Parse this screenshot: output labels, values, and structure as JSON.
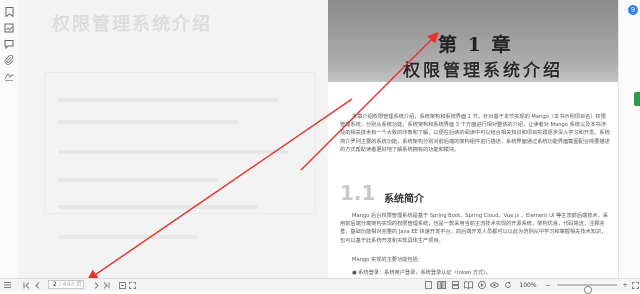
{
  "book": {
    "chapter_number": "第 1 章",
    "chapter_title": "权限管理系统介绍",
    "intro_text": "本章介绍权限管理系统介绍，系统架构和系统界面 1 节，针对基于本节实现的 Mango（本书示例项目名）权限管理系统，分别从系统功能，系统架构和系统界面 3 个方面进行相对整体的介绍，让读者对 Mango 系统以及本书涉及的相关技术有一个大致的印象和了解，以便在后续的阅读中可以结合相关知识和项目实践逐步深入学习和开发。系统简介罗列主要的系统功能，系统架构分别对前后端的架构组件进行描述，系统界面通过系统功能界面截图配合简要描述的方式帮助读者更好地了解系统拥有的功能和模块。",
    "section_number": "1.1",
    "section_title": "系统简介",
    "section_text": "Mango 后台权限管理系统是基于 Spring Boot、Spring Cloud、Vue.js 、Element UI 等主流前后端技术，采用前后端分离架构实现的权限管理系统，也是一款采用当前主流技术实现的开源系统，架构优良，代码简洁，注释完善，基础功能相对完整的 Java EE 快速开发平台，前后端开发人员都可以以此为范例从中学习和掌握相关技术知识，也可以基于此系统开发和实现具体生产项目。",
    "section_sub": "Mango 实现的主要功能包括：",
    "bullet": "系统登录：系统用户登录，系统登录认证（token 方式）。"
  },
  "ghost": {
    "title": "权限管理系统介绍"
  },
  "status_bar": {
    "page_current": "2",
    "page_total": "/ 443 页",
    "zoom": "100%",
    "zoom_minus": "−",
    "zoom_plus": "+"
  },
  "right_bar": {
    "badge": "9"
  },
  "colors": {
    "arrow": "#e8322b",
    "banner": "#9c9c9c",
    "accent": "#2f7ef7"
  }
}
